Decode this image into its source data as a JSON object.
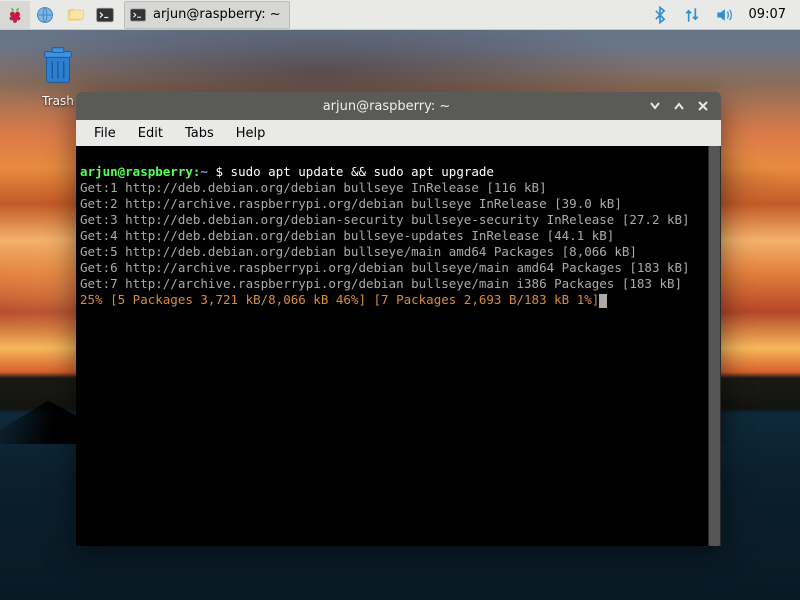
{
  "panel": {
    "launchers": [
      {
        "name": "menu-raspberry-icon"
      },
      {
        "name": "web-browser-icon"
      },
      {
        "name": "file-manager-icon"
      },
      {
        "name": "terminal-icon"
      }
    ],
    "task": {
      "label": "arjun@raspberry: ~"
    },
    "clock": "09:07"
  },
  "desktop": {
    "trash_label": "Trash"
  },
  "window": {
    "title": "arjun@raspberry: ~",
    "menu": [
      "File",
      "Edit",
      "Tabs",
      "Help"
    ]
  },
  "terminal": {
    "prompt_user_host": "arjun@raspberry:",
    "prompt_cwd": "~",
    "prompt_sym": "$",
    "command": "sudo apt update && sudo apt upgrade",
    "lines": [
      "Get:1 http://deb.debian.org/debian bullseye InRelease [116 kB]",
      "Get:2 http://archive.raspberrypi.org/debian bullseye InRelease [39.0 kB]",
      "Get:3 http://deb.debian.org/debian-security bullseye-security InRelease [27.2 kB]",
      "Get:4 http://deb.debian.org/debian bullseye-updates InRelease [44.1 kB]",
      "Get:5 http://deb.debian.org/debian bullseye/main amd64 Packages [8,066 kB]",
      "Get:6 http://archive.raspberrypi.org/debian bullseye/main amd64 Packages [183 kB]",
      "Get:7 http://archive.raspberrypi.org/debian bullseye/main i386 Packages [183 kB]"
    ],
    "progress": "25% [5 Packages 3,721 kB/8,066 kB 46%] [7 Packages 2,693 B/183 kB 1%]"
  }
}
